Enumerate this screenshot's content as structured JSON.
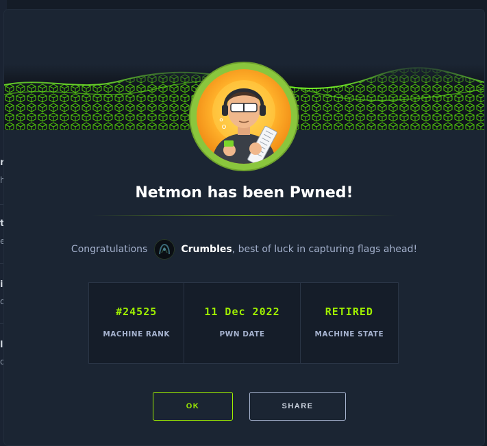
{
  "modal": {
    "title": "Netmon has been Pwned!",
    "congrats_prefix": "Congratulations",
    "username": "Crumbles",
    "congrats_suffix": ", best of luck in capturing flags ahead!"
  },
  "stats": [
    {
      "value": "#24525",
      "label": "MACHINE RANK"
    },
    {
      "value": "11 Dec 2022",
      "label": "PWN DATE"
    },
    {
      "value": "RETIRED",
      "label": "MACHINE STATE"
    }
  ],
  "buttons": {
    "ok": "OK",
    "share": "SHARE"
  },
  "background_fragments": [
    {
      "text": "n",
      "style": "title"
    },
    {
      "text": "hi",
      "style": "sub"
    },
    {
      "text": "t",
      "style": "title"
    },
    {
      "text": "e",
      "style": "sub"
    },
    {
      "text": "i",
      "style": "title"
    },
    {
      "text": "o",
      "style": "sub"
    },
    {
      "text": "l",
      "style": "title"
    },
    {
      "text": "di",
      "style": "sub"
    }
  ],
  "colors": {
    "accent": "#9fef00",
    "modal_bg": "#1b2533",
    "text_muted": "#a4b1cd",
    "avatar_ring": "#8ac63d"
  },
  "icons": {
    "avatar": "hacker-avatar-icon",
    "user_avatar": "user-avatar-icon"
  }
}
